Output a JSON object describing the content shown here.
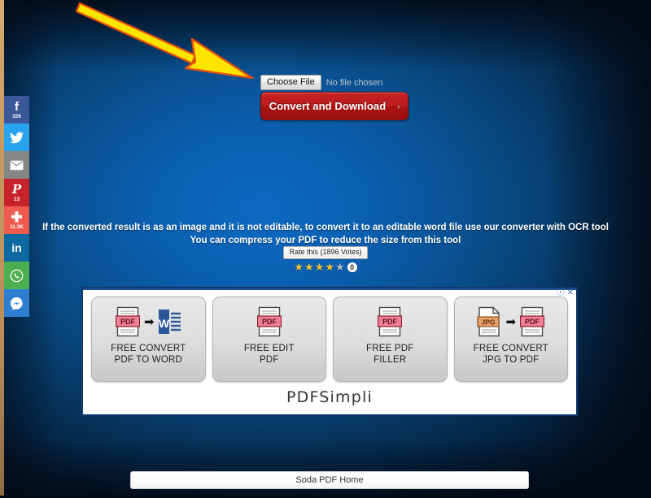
{
  "page": {
    "background_center_color": "#0d6ac2",
    "background_edge_color": "#020f1e"
  },
  "annotation": {
    "arrow_name": "yellow-arrow-pointing-to-choose-file",
    "fill_color": "#ffe400",
    "stroke_color": "#e34b0a"
  },
  "upload": {
    "choose_file_label": "Choose File",
    "no_file_text": "No file chosen",
    "convert_button_label": "Convert and Download",
    "convert_button_chevron": "›",
    "convert_button_color": "#b81c1c"
  },
  "info": {
    "line1": "If the converted result is as an image and it is not editable, to convert it to an editable word file use our converter with OCR tool",
    "line2": "You can compress your PDF to reduce the size from this tool"
  },
  "rating": {
    "tooltip": "Rate this (1896 Votes)",
    "stars": [
      {
        "filled": true,
        "glyph": "★"
      },
      {
        "filled": true,
        "glyph": "★"
      },
      {
        "filled": true,
        "glyph": "★"
      },
      {
        "filled": true,
        "glyph": "★"
      },
      {
        "filled": false,
        "glyph": "★"
      }
    ],
    "filled_count": 4,
    "total_stars": 5,
    "vote_badge": "0",
    "star_color": "#f2c233",
    "star_off_color": "#b6bcc4"
  },
  "social_sidebar": {
    "items": [
      {
        "name": "facebook",
        "glyph": "f",
        "count": "326",
        "color": "#3b5998"
      },
      {
        "name": "twitter",
        "glyph": "🐦",
        "count": "",
        "color": "#2aa3ef"
      },
      {
        "name": "email",
        "glyph": "✉",
        "count": "",
        "color": "#878787"
      },
      {
        "name": "pinterest",
        "glyph": "P",
        "count": "13",
        "color": "#c8232c"
      },
      {
        "name": "share",
        "glyph": "✚",
        "count": "11.3K",
        "color": "#ef5c4e"
      },
      {
        "name": "linkedin",
        "glyph": "in",
        "count": "",
        "color": "#0c69a2"
      },
      {
        "name": "whatsapp",
        "glyph": "✆",
        "count": "",
        "color": "#4caf50"
      },
      {
        "name": "messenger",
        "glyph": "⚡",
        "count": "",
        "color": "#2f7fd1"
      }
    ]
  },
  "ad": {
    "brand": "PDFSimpli",
    "info_icon": "ⓘ",
    "close_icon": "✕",
    "tiles": [
      {
        "label_line1": "FREE CONVERT",
        "label_line2": "PDF TO WORD",
        "from": "PDF",
        "to": "W"
      },
      {
        "label_line1": "FREE EDIT",
        "label_line2": "PDF",
        "from": "PDF",
        "to": ""
      },
      {
        "label_line1": "FREE PDF",
        "label_line2": "FILLER",
        "from": "PDF",
        "to": ""
      },
      {
        "label_line1": "FREE CONVERT",
        "label_line2": "JPG TO PDF",
        "from": "JPG",
        "to": "PDF"
      }
    ]
  },
  "bottom_bar": {
    "label": "Soda PDF Home"
  }
}
